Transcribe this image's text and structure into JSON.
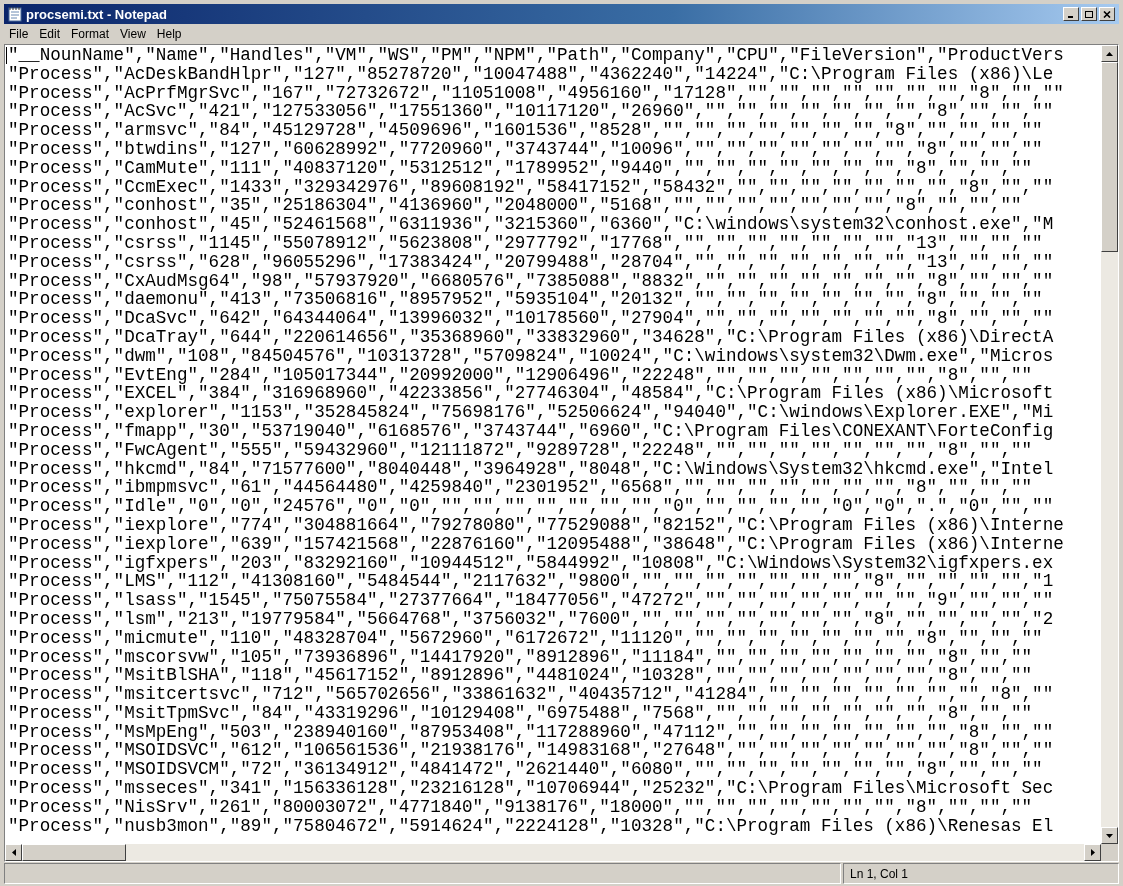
{
  "window": {
    "title": "procsemi.txt - Notepad"
  },
  "menu": [
    "File",
    "Edit",
    "Format",
    "View",
    "Help"
  ],
  "lines": [
    "\"__NounName\",\"Name\",\"Handles\",\"VM\",\"WS\",\"PM\",\"NPM\",\"Path\",\"Company\",\"CPU\",\"FileVersion\",\"ProductVers",
    "\"Process\",\"AcDeskBandHlpr\",\"127\",\"85278720\",\"10047488\",\"4362240\",\"14224\",\"C:\\Program Files (x86)\\Le",
    "\"Process\",\"AcPrfMgrSvc\",\"167\",\"72732672\",\"11051008\",\"4956160\",\"17128\",\"\",\"\",\"\",\"\",\"\",\"\",\"\",\"8\",\"\",\"\"",
    "\"Process\",\"AcSvc\",\"421\",\"127533056\",\"17551360\",\"10117120\",\"26960\",\"\",\"\",\"\",\"\",\"\",\"\",\"\",\"8\",\"\",\"\",\"\"",
    "\"Process\",\"armsvc\",\"84\",\"45129728\",\"4509696\",\"1601536\",\"8528\",\"\",\"\",\"\",\"\",\"\",\"\",\"\",\"8\",\"\",\"\",\"\",\"\"",
    "\"Process\",\"btwdins\",\"127\",\"60628992\",\"7720960\",\"3743744\",\"10096\",\"\",\"\",\"\",\"\",\"\",\"\",\"\",\"8\",\"\",\"\",\"\"",
    "\"Process\",\"CamMute\",\"111\",\"40837120\",\"5312512\",\"1789952\",\"9440\",\"\",\"\",\"\",\"\",\"\",\"\",\"\",\"8\",\"\",\"\",\"\"",
    "\"Process\",\"CcmExec\",\"1433\",\"329342976\",\"89608192\",\"58417152\",\"58432\",\"\",\"\",\"\",\"\",\"\",\"\",\"\",\"8\",\"\",\"\"",
    "\"Process\",\"conhost\",\"35\",\"25186304\",\"4136960\",\"2048000\",\"5168\",\"\",\"\",\"\",\"\",\"\",\"\",\"\",\"8\",\"\",\"\",\"\"",
    "\"Process\",\"conhost\",\"45\",\"52461568\",\"6311936\",\"3215360\",\"6360\",\"C:\\windows\\system32\\conhost.exe\",\"M",
    "\"Process\",\"csrss\",\"1145\",\"55078912\",\"5623808\",\"2977792\",\"17768\",\"\",\"\",\"\",\"\",\"\",\"\",\"\",\"13\",\"\",\"\",\"\"",
    "\"Process\",\"csrss\",\"628\",\"96055296\",\"17383424\",\"20799488\",\"28704\",\"\",\"\",\"\",\"\",\"\",\"\",\"\",\"13\",\"\",\"\",\"\"",
    "\"Process\",\"CxAudMsg64\",\"98\",\"57937920\",\"6680576\",\"7385088\",\"8832\",\"\",\"\",\"\",\"\",\"\",\"\",\"\",\"8\",\"\",\"\",\"\"",
    "\"Process\",\"daemonu\",\"413\",\"73506816\",\"8957952\",\"5935104\",\"20132\",\"\",\"\",\"\",\"\",\"\",\"\",\"\",\"8\",\"\",\"\",\"\"",
    "\"Process\",\"DcaSvc\",\"642\",\"64344064\",\"13996032\",\"10178560\",\"27904\",\"\",\"\",\"\",\"\",\"\",\"\",\"\",\"8\",\"\",\"\",\"\"",
    "\"Process\",\"DcaTray\",\"644\",\"220614656\",\"35368960\",\"33832960\",\"34628\",\"C:\\Program Files (x86)\\DirectA",
    "\"Process\",\"dwm\",\"108\",\"84504576\",\"10313728\",\"5709824\",\"10024\",\"C:\\windows\\system32\\Dwm.exe\",\"Micros",
    "\"Process\",\"EvtEng\",\"284\",\"105017344\",\"20992000\",\"12906496\",\"22248\",\"\",\"\",\"\",\"\",\"\",\"\",\"\",\"8\",\"\",\"\"",
    "\"Process\",\"EXCEL\",\"384\",\"316968960\",\"42233856\",\"27746304\",\"48584\",\"C:\\Program Files (x86)\\Microsoft",
    "\"Process\",\"explorer\",\"1153\",\"352845824\",\"75698176\",\"52506624\",\"94040\",\"C:\\windows\\Explorer.EXE\",\"Mi",
    "\"Process\",\"fmapp\",\"30\",\"53719040\",\"6168576\",\"3743744\",\"6960\",\"C:\\Program Files\\CONEXANT\\ForteConfig",
    "\"Process\",\"FwcAgent\",\"555\",\"59432960\",\"12111872\",\"9289728\",\"22248\",\"\",\"\",\"\",\"\",\"\",\"\",\"\",\"8\",\"\",\"\"",
    "\"Process\",\"hkcmd\",\"84\",\"71577600\",\"8040448\",\"3964928\",\"8048\",\"C:\\Windows\\System32\\hkcmd.exe\",\"Intel",
    "\"Process\",\"ibmpmsvc\",\"61\",\"44564480\",\"4259840\",\"2301952\",\"6568\",\"\",\"\",\"\",\"\",\"\",\"\",\"\",\"8\",\"\",\"\",\"\"",
    "\"Process\",\"Idle\",\"0\",\"0\",\"24576\",\"0\",\"0\",\"\",\"\",\"\",\"\",\"\",\"\",\"\",\"0\",\"\",\"\",\"\",\"\",\"0\",\"0\",\".\",\"0\",\"\",\"\"",
    "\"Process\",\"iexplore\",\"774\",\"304881664\",\"79278080\",\"77529088\",\"82152\",\"C:\\Program Files (x86)\\Interne",
    "\"Process\",\"iexplore\",\"639\",\"157421568\",\"22876160\",\"12095488\",\"38648\",\"C:\\Program Files (x86)\\Interne",
    "\"Process\",\"igfxpers\",\"203\",\"83292160\",\"10944512\",\"5844992\",\"10808\",\"C:\\Windows\\System32\\igfxpers.ex",
    "\"Process\",\"LMS\",\"112\",\"41308160\",\"5484544\",\"2117632\",\"9800\",\"\",\"\",\"\",\"\",\"\",\"\",\"\",\"8\",\"\",\"\",\"\",\"\",\"1",
    "\"Process\",\"lsass\",\"1545\",\"75075584\",\"27377664\",\"18477056\",\"47272\",\"\",\"\",\"\",\"\",\"\",\"\",\"\",\"9\",\"\",\"\",\"\"",
    "\"Process\",\"lsm\",\"213\",\"19779584\",\"5664768\",\"3756032\",\"7600\",\"\",\"\",\"\",\"\",\"\",\"\",\"\",\"8\",\"\",\"\",\"\",\"\",\"2",
    "\"Process\",\"micmute\",\"110\",\"48328704\",\"5672960\",\"6172672\",\"11120\",\"\",\"\",\"\",\"\",\"\",\"\",\"\",\"8\",\"\",\"\",\"\"",
    "\"Process\",\"mscorsvw\",\"105\",\"73936896\",\"14417920\",\"8912896\",\"11184\",\"\",\"\",\"\",\"\",\"\",\"\",\"\",\"8\",\"\",\"\"",
    "\"Process\",\"MsitBlSHA\",\"118\",\"45617152\",\"8912896\",\"4481024\",\"10328\",\"\",\"\",\"\",\"\",\"\",\"\",\"\",\"8\",\"\",\"\"",
    "\"Process\",\"msitcertsvc\",\"712\",\"565702656\",\"33861632\",\"40435712\",\"41284\",\"\",\"\",\"\",\"\",\"\",\"\",\"\",\"8\",\"\"",
    "\"Process\",\"MsitTpmSvc\",\"84\",\"43319296\",\"10129408\",\"6975488\",\"7568\",\"\",\"\",\"\",\"\",\"\",\"\",\"\",\"8\",\"\",\"\"",
    "\"Process\",\"MsMpEng\",\"503\",\"238940160\",\"87953408\",\"117288960\",\"47112\",\"\",\"\",\"\",\"\",\"\",\"\",\"\",\"8\",\"\",\"\"",
    "\"Process\",\"MSOIDSVC\",\"612\",\"106561536\",\"21938176\",\"14983168\",\"27648\",\"\",\"\",\"\",\"\",\"\",\"\",\"\",\"8\",\"\",\"\"",
    "\"Process\",\"MSOIDSVCM\",\"72\",\"36134912\",\"4841472\",\"2621440\",\"6080\",\"\",\"\",\"\",\"\",\"\",\"\",\"\",\"8\",\"\",\"\",\"\"",
    "\"Process\",\"msseces\",\"341\",\"156336128\",\"23216128\",\"10706944\",\"25232\",\"C:\\Program Files\\Microsoft Sec",
    "\"Process\",\"NisSrv\",\"261\",\"80003072\",\"4771840\",\"9138176\",\"18000\",\"\",\"\",\"\",\"\",\"\",\"\",\"\",\"8\",\"\",\"\",\"\"",
    "\"Process\",\"nusb3mon\",\"89\",\"75804672\",\"5914624\",\"2224128\",\"10328\",\"C:\\Program Files (x86)\\Renesas El"
  ],
  "status_bar": {
    "position": "Ln 1, Col 1"
  }
}
